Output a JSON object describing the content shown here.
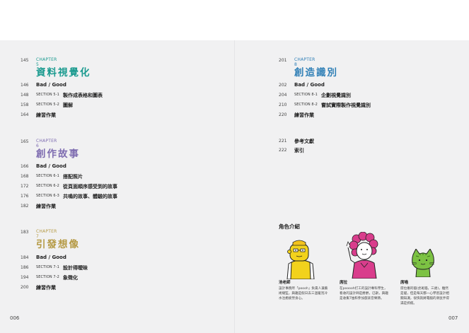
{
  "left": {
    "folio": "006",
    "chapters": [
      {
        "page": "145",
        "label": "CHAPTER 5",
        "title": "資料視覺化",
        "color": "#1a9a8f",
        "rows": [
          {
            "page": "146",
            "section": "",
            "text": "Bad / Good"
          },
          {
            "page": "148",
            "section": "SECTION 5-1",
            "text": "製作成表格和圖表"
          },
          {
            "page": "158",
            "section": "SECTION 5-2",
            "text": "圖解"
          },
          {
            "page": "164",
            "section": "",
            "text": "練習作業"
          }
        ]
      },
      {
        "page": "165",
        "label": "CHAPTER 6",
        "title": "創作故事",
        "color": "#7e6cb0",
        "rows": [
          {
            "page": "166",
            "section": "",
            "text": "Bad / Good"
          },
          {
            "page": "168",
            "section": "SECTION 6-1",
            "text": "搭配照片"
          },
          {
            "page": "172",
            "section": "SECTION 6-2",
            "text": "從頁面順序感受到的故事"
          },
          {
            "page": "176",
            "section": "SECTION 6-3",
            "text": "共鳴的故事、體驗的故事"
          },
          {
            "page": "182",
            "section": "",
            "text": "練習作業"
          }
        ]
      },
      {
        "page": "183",
        "label": "CHAPTER 7",
        "title": "引發想像",
        "color": "#b59a45",
        "rows": [
          {
            "page": "184",
            "section": "",
            "text": "Bad / Good"
          },
          {
            "page": "186",
            "section": "SECTION 7-1",
            "text": "設計得曖昧"
          },
          {
            "page": "194",
            "section": "SECTION 7-2",
            "text": "象徵化"
          },
          {
            "page": "200",
            "section": "",
            "text": "練習作業"
          }
        ]
      }
    ]
  },
  "right": {
    "folio": "007",
    "chapter": {
      "page": "201",
      "label": "CHAPTER 8",
      "title": "創造識別",
      "color": "#2f7fb6",
      "rows": [
        {
          "page": "202",
          "section": "",
          "text": "Bad / Good"
        },
        {
          "page": "204",
          "section": "SECTION 8-1",
          "text": "企劃視覺識別"
        },
        {
          "page": "210",
          "section": "SECTION 8-2",
          "text": "嘗試實際製作視覺識別"
        },
        {
          "page": "220",
          "section": "",
          "text": "練習作業"
        }
      ]
    },
    "extras": [
      {
        "page": "221",
        "text": "參考文獻"
      },
      {
        "page": "222",
        "text": "索引"
      }
    ],
    "characters_title": "角色介紹",
    "characters": [
      {
        "name": "池老師",
        "desc": "設計事務所「poooh」負責人兼藝術總監，興趣是假日去三溫暖泡冷水治癒疲勞身心。",
        "icon": "yellow-bald-teacher"
      },
      {
        "name": "席拉",
        "desc": "在pooooh打工的設計專科學生，看收的設計師是爵爵，已斯，興趣是收集T恤和參加戲滚音樂節。",
        "icon": "pink-curly-haired-student"
      },
      {
        "name": "席喵",
        "desc": "席拉養的貓(虎斑貓，三歲)，雖然是貓，但是每天都一心學習設計相關知識，很快就將電腦的滑鼠弄得滿是抓痕。",
        "icon": "green-cat"
      }
    ]
  }
}
